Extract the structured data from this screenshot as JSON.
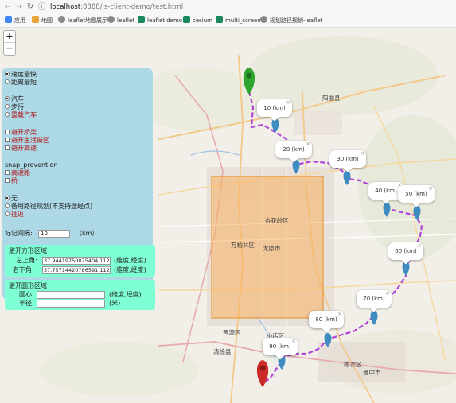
{
  "browser": {
    "back_icon": "arrow-left-icon",
    "forward_icon": "arrow-right-icon",
    "reload_icon": "reload-icon",
    "info_icon": "info-icon",
    "url_host": "localhost",
    "url_path": ":8888/js-client-demo/test.html"
  },
  "bookmarks": [
    {
      "label": "应用",
      "color": "#4285f4"
    },
    {
      "label": "地图",
      "color": "#e8a33a"
    },
    {
      "label": "leaflet地图展示",
      "color": "#777777"
    },
    {
      "label": "leaflet",
      "color": "#777777"
    },
    {
      "label": "leaflet demo",
      "color": "#1c8a5c"
    },
    {
      "label": "cesium",
      "color": "#1c8a5c"
    },
    {
      "label": "multi_screen",
      "color": "#1c8a5c"
    },
    {
      "label": "规划路径规划-leaflet",
      "color": "#777777"
    }
  ],
  "zoom": {
    "plus": "+",
    "minus": "−"
  },
  "panel": {
    "strategy": [
      {
        "label": "速度最快",
        "checked": true
      },
      {
        "label": "距离最短",
        "checked": false
      }
    ],
    "vehicle": [
      {
        "label": "汽车",
        "checked": true
      },
      {
        "label": "步行",
        "checked": false
      },
      {
        "label": "重载汽车",
        "checked": false,
        "red": true
      }
    ],
    "avoid": [
      {
        "label": "避开桥梁"
      },
      {
        "label": "避开生活街区"
      },
      {
        "label": "避开高速"
      }
    ],
    "snap_title": "snap_prevention",
    "snap": [
      {
        "label": "高速路"
      },
      {
        "label": "桥"
      }
    ],
    "alt": [
      {
        "label": "无",
        "checked": true
      },
      {
        "label": "备用路径规划(不支持途经点)",
        "checked": false
      },
      {
        "label": "往返",
        "checked": false,
        "red": true
      }
    ],
    "interval_label": "标记间隔:",
    "interval_value": "10",
    "interval_unit": "（km）",
    "rect_box": {
      "title": "避开方形区域",
      "top_left_label": "左上角:",
      "top_left_value": "37.94419750075404,112.46",
      "top_left_hint": "(维度,经度)",
      "bottom_right_label": "右下角:",
      "bottom_right_value": "37.75714420786591,112.65",
      "bottom_right_hint": "(维度,经度)"
    },
    "circle_box": {
      "title": "避开圆形区域",
      "center_label": "圆心:",
      "center_hint": "(维度,经度)",
      "radius_label": "半径:",
      "radius_hint": "(米)"
    }
  },
  "popups": [
    {
      "text": "10 (km)",
      "close": "×"
    },
    {
      "text": "20 (km)",
      "close": "×"
    },
    {
      "text": "30 (km)",
      "close": "×"
    },
    {
      "text": "40 (km)",
      "close": "×"
    },
    {
      "text": "50 (km)",
      "close": "×"
    },
    {
      "text": "60 (km)",
      "close": "×"
    },
    {
      "text": "70 (km)",
      "close": "×"
    },
    {
      "text": "80 (km)",
      "close": "×"
    },
    {
      "text": "90 (km)",
      "close": "×"
    }
  ],
  "map_labels": {
    "yangqu": "阳曲县",
    "wanbailin": "万柏林区",
    "taiyuan": "太原市",
    "xinghualing": "杏花岭区",
    "jinyuan": "晋源区",
    "xiaodian": "小店区",
    "yuci": "榆次区",
    "jinzhong": "晋中市",
    "qingxu": "清徐县"
  },
  "colors": {
    "route": "#b044d8",
    "marker": "#3e8cc2",
    "start_marker": "#2ea52e",
    "end_marker": "#cc2a2a",
    "avoid_rect_fill": "#f7b060",
    "avoid_rect_stroke": "#e89a3a",
    "panel_bg": "#add8e6",
    "box_bg": "#7fffd4"
  }
}
